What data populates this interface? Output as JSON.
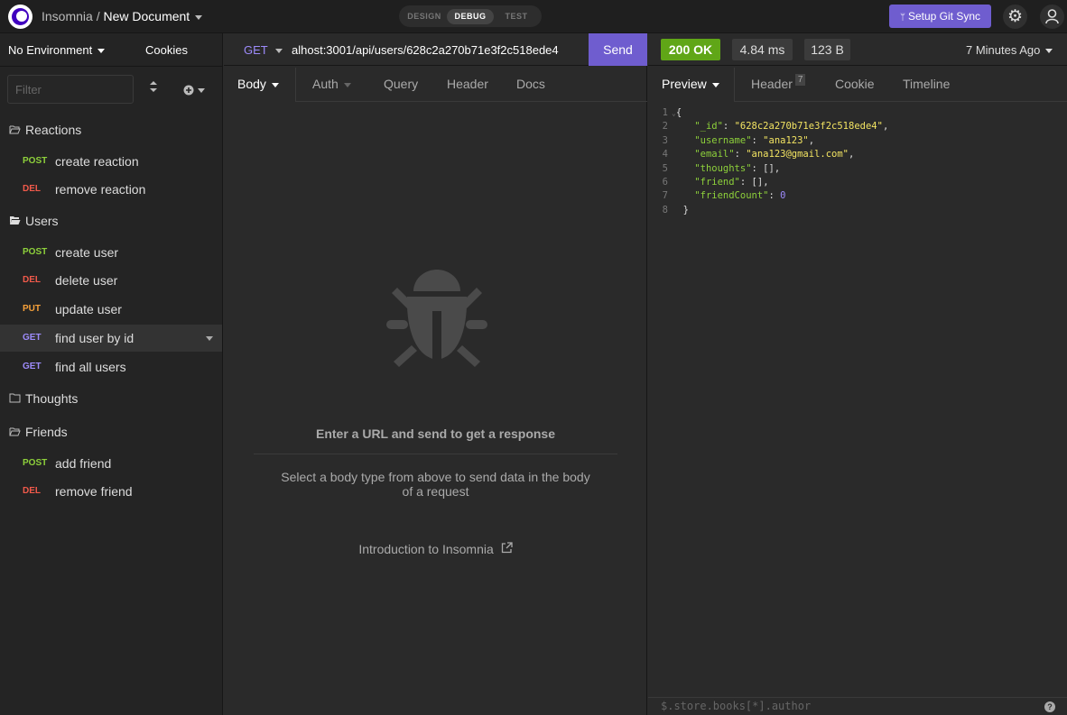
{
  "topbar": {
    "app_name": "Insomnia",
    "separator": "/",
    "document": "New Document",
    "modes": [
      "DESIGN",
      "DEBUG",
      "TEST"
    ],
    "active_mode": "DEBUG",
    "git_sync": "Setup Git Sync",
    "git_icon": "git-branch-icon",
    "settings_icon": "gear-icon",
    "account_icon": "user-icon"
  },
  "sidebar": {
    "environment": "No Environment",
    "cookies": "Cookies",
    "filter_placeholder": "Filter",
    "folders": [
      {
        "name": "Reactions",
        "open": true,
        "requests": [
          {
            "method": "POST",
            "name": "create reaction"
          },
          {
            "method": "DEL",
            "name": "remove reaction"
          }
        ]
      },
      {
        "name": "Users",
        "open": true,
        "requests": [
          {
            "method": "POST",
            "name": "create user"
          },
          {
            "method": "DEL",
            "name": "delete user"
          },
          {
            "method": "PUT",
            "name": "update user"
          },
          {
            "method": "GET",
            "name": "find user by id",
            "active": true
          },
          {
            "method": "GET",
            "name": "find all users"
          }
        ]
      },
      {
        "name": "Thoughts",
        "open": false,
        "requests": []
      },
      {
        "name": "Friends",
        "open": true,
        "requests": [
          {
            "method": "POST",
            "name": "add friend"
          },
          {
            "method": "DEL",
            "name": "remove friend"
          }
        ]
      }
    ]
  },
  "request": {
    "method": "GET",
    "url": "alhost:3001/api/users/628c2a270b71e3f2c518ede4",
    "send": "Send",
    "tabs": [
      "Body",
      "Auth",
      "Query",
      "Header",
      "Docs"
    ],
    "empty_title": "Enter a URL and send to get a response",
    "empty_hint": "Select a body type from above to send data in the body of a request",
    "intro_link": "Introduction to Insomnia"
  },
  "response": {
    "status": "200 OK",
    "time": "4.84 ms",
    "size": "123 B",
    "ago": "7 Minutes Ago",
    "tabs": [
      "Preview",
      "Header",
      "Cookie",
      "Timeline"
    ],
    "header_count": "7",
    "lines": [
      {
        "n": "1",
        "text": "{"
      },
      {
        "n": "2",
        "key": "\"_id\"",
        "val": "\"628c2a270b71e3f2c518ede4\"",
        "type": "s",
        "end": ","
      },
      {
        "n": "3",
        "key": "\"username\"",
        "val": "\"ana123\"",
        "type": "s",
        "end": ","
      },
      {
        "n": "4",
        "key": "\"email\"",
        "val": "\"ana123@gmail.com\"",
        "type": "s",
        "end": ","
      },
      {
        "n": "5",
        "key": "\"thoughts\"",
        "val": "[]",
        "type": "p",
        "end": ","
      },
      {
        "n": "6",
        "key": "\"friend\"",
        "val": "[]",
        "type": "p",
        "end": ","
      },
      {
        "n": "7",
        "key": "\"friendCount\"",
        "val": "0",
        "type": "n",
        "end": ""
      },
      {
        "n": "8",
        "text": "}"
      }
    ],
    "filter_placeholder": "$.store.books[*].author"
  }
}
